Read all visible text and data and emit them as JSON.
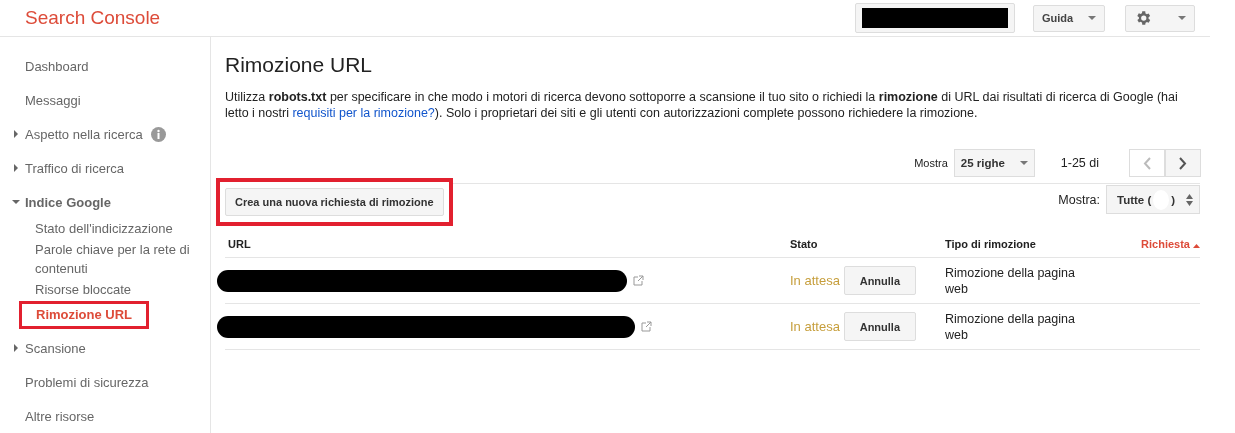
{
  "header": {
    "logo": "Search Console",
    "help_button": "Guida"
  },
  "sidebar": {
    "items": [
      {
        "label": "Dashboard",
        "kind": "link",
        "selected": false
      },
      {
        "label": "Messaggi",
        "kind": "link",
        "selected": false
      },
      {
        "label": "Aspetto nella ricerca",
        "kind": "section",
        "expanded": false,
        "info": true,
        "selected": false
      },
      {
        "label": "Traffico di ricerca",
        "kind": "section",
        "expanded": false,
        "selected": false
      },
      {
        "label": "Indice Google",
        "kind": "section",
        "expanded": true,
        "selected": false,
        "children": [
          {
            "label": "Stato dell'indicizzazione",
            "selected": false,
            "annotated": false
          },
          {
            "label": "Parole chiave per la rete di contenuti",
            "selected": false,
            "annotated": false
          },
          {
            "label": "Risorse bloccate",
            "selected": false,
            "annotated": false
          },
          {
            "label": "Rimozione URL",
            "selected": true,
            "annotated": true
          }
        ]
      },
      {
        "label": "Scansione",
        "kind": "section",
        "expanded": false,
        "selected": false
      },
      {
        "label": "Problemi di sicurezza",
        "kind": "link",
        "selected": false
      },
      {
        "label": "Altre risorse",
        "kind": "link",
        "selected": false
      }
    ]
  },
  "main": {
    "title": "Rimozione URL",
    "description": {
      "before": "Utilizza **robots.txt** per specificare in che modo i motori di ricerca devono sottoporre a scansione il tuo sito o richiedi la **rimozione** di URL dai risultati di ricerca di Google (hai letto i nostri ",
      "link": "requisiti per la rimozione?",
      "after": "). Solo i proprietari dei siti e gli utenti con autorizzazioni complete possono richiedere la rimozione."
    },
    "pager": {
      "label": "Mostra",
      "rows": "25 righe",
      "range": "1-25 di",
      "prev_disabled": true
    },
    "new_request_button": {
      "label": "Crea una nuova richiesta di rimozione",
      "annotated": true
    },
    "filter": {
      "label": "Mostra:",
      "value_start": "Tutte (",
      "value_end": ")"
    },
    "table": {
      "columns": [
        {
          "label": "URL",
          "sorted": false
        },
        {
          "label": "Stato",
          "sorted": false
        },
        {
          "label": "Tipo di rimozione",
          "sorted": false
        },
        {
          "label": "Richiesta",
          "sorted": true
        }
      ],
      "rows": [
        {
          "status": "In attesa",
          "action": "Annulla",
          "type": "Rimozione della pagina web"
        },
        {
          "status": "In attesa",
          "action": "Annulla",
          "type": "Rimozione della pagina web"
        }
      ]
    }
  }
}
